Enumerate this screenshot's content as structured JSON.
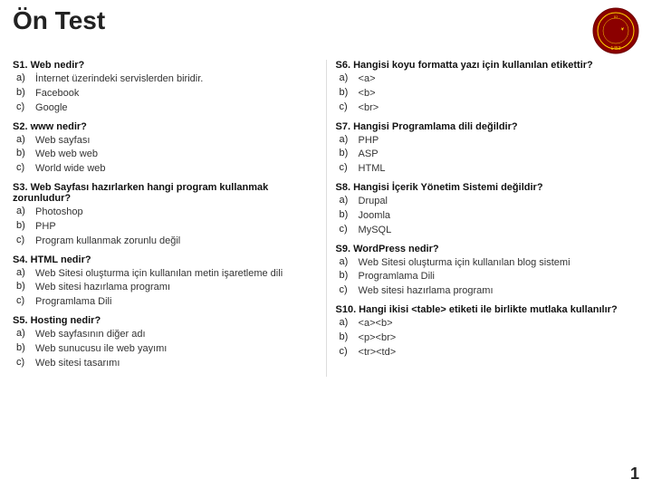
{
  "title": "Ön Test",
  "page_number": "1",
  "left_column": [
    {
      "id": "s1",
      "question": "S1. Web nedir?",
      "answers": [
        {
          "label": "a)",
          "text": "İnternet üzerindeki servislerden biridir."
        },
        {
          "label": "b)",
          "text": "Facebook"
        },
        {
          "label": "c)",
          "text": "Google"
        }
      ]
    },
    {
      "id": "s2",
      "question": "S2. www nedir?",
      "answers": [
        {
          "label": "a)",
          "text": "Web sayfası"
        },
        {
          "label": "b)",
          "text": "Web web web"
        },
        {
          "label": "c)",
          "text": "World wide web"
        }
      ]
    },
    {
      "id": "s3",
      "question": "S3. Web Sayfası hazırlarken hangi program kullanmak zorunludur?",
      "answers": [
        {
          "label": "a)",
          "text": "Photoshop"
        },
        {
          "label": "b)",
          "text": "PHP"
        },
        {
          "label": "c)",
          "text": "Program kullanmak zorunlu değil"
        }
      ]
    },
    {
      "id": "s4",
      "question": "S4. HTML nedir?",
      "answers": [
        {
          "label": "a)",
          "text": "Web Sitesi oluşturma için kullanılan metin işaretleme dili"
        },
        {
          "label": "b)",
          "text": "Web sitesi hazırlama programı"
        },
        {
          "label": "c)",
          "text": "Programlama Dili"
        }
      ]
    },
    {
      "id": "s5",
      "question": "S5. Hosting nedir?",
      "answers": [
        {
          "label": "a)",
          "text": "Web sayfasının diğer adı"
        },
        {
          "label": "b)",
          "text": "Web sunucusu ile web yayımı"
        },
        {
          "label": "c)",
          "text": "Web sitesi tasarımı"
        }
      ]
    }
  ],
  "right_column": [
    {
      "id": "s6",
      "question": "S6. Hangisi koyu formatta yazı için kullanılan etikettir?",
      "answers": [
        {
          "label": "a)",
          "text": "<a>"
        },
        {
          "label": "b)",
          "text": "<b>"
        },
        {
          "label": "c)",
          "text": "<br>"
        }
      ]
    },
    {
      "id": "s7",
      "question": "S7. Hangisi Programlama dili değildir?",
      "answers": [
        {
          "label": "a)",
          "text": "PHP"
        },
        {
          "label": "b)",
          "text": "ASP"
        },
        {
          "label": "c)",
          "text": "HTML"
        }
      ]
    },
    {
      "id": "s8",
      "question": "S8. Hangisi İçerik Yönetim Sistemi değildir?",
      "answers": [
        {
          "label": "a)",
          "text": "Drupal"
        },
        {
          "label": "b)",
          "text": "Joomla"
        },
        {
          "label": "c)",
          "text": "MySQL"
        }
      ]
    },
    {
      "id": "s9",
      "question": "S9. WordPress nedir?",
      "answers": [
        {
          "label": "a)",
          "text": "Web Sitesi oluşturma için kullanılan blog sistemi"
        },
        {
          "label": "b)",
          "text": "Programlama Dili"
        },
        {
          "label": "c)",
          "text": "Web sitesi hazırlama programı"
        }
      ]
    },
    {
      "id": "s10",
      "question": "S10. Hangi ikisi <table> etiketi ile birlikte mutlaka kullanılır?",
      "answers": [
        {
          "label": "a)",
          "text": "<a><b>"
        },
        {
          "label": "b)",
          "text": "<p><br>"
        },
        {
          "label": "c)",
          "text": "<tr><td>"
        }
      ]
    }
  ]
}
